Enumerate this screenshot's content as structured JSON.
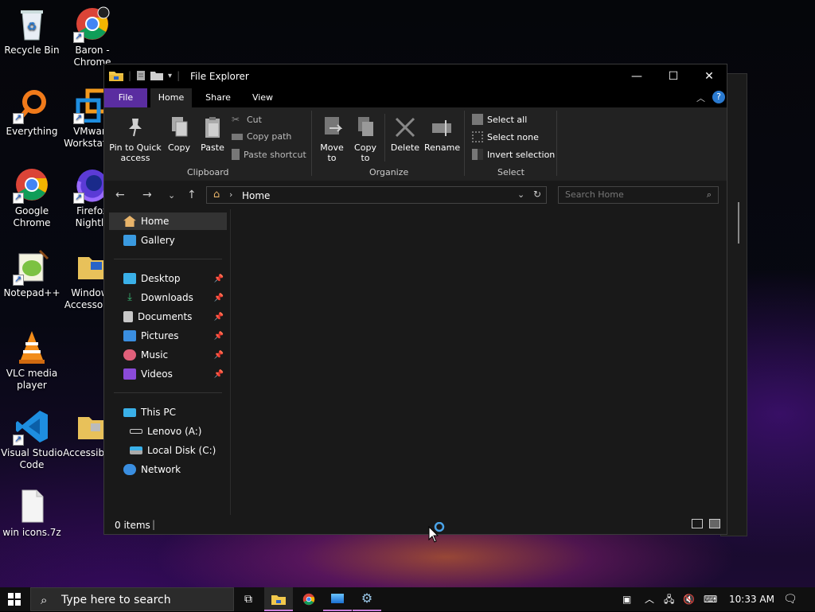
{
  "desktop": {
    "icons": [
      {
        "label": "Recycle Bin"
      },
      {
        "label": "Baron - Chrome"
      },
      {
        "label": "Everything"
      },
      {
        "label": "VMware Workstation"
      },
      {
        "label": "Google Chrome"
      },
      {
        "label": "Firefox Nightly"
      },
      {
        "label": "Notepad++"
      },
      {
        "label": "Windows Accessories"
      },
      {
        "label": "VLC media player"
      },
      {
        "label": "Visual Studio Code"
      },
      {
        "label": "Accessibility"
      },
      {
        "label": "win icons.7z"
      }
    ]
  },
  "window": {
    "title": "File Explorer",
    "controls": {
      "minimize": "—",
      "maximize": "☐",
      "close": "✕"
    },
    "tabs": {
      "file": "File",
      "home": "Home",
      "share": "Share",
      "view": "View"
    },
    "ribbon": {
      "clipboard": {
        "pin": "Pin to Quick access",
        "copy": "Copy",
        "paste": "Paste",
        "cut": "Cut",
        "copy_path": "Copy path",
        "paste_shortcut": "Paste shortcut",
        "group": "Clipboard"
      },
      "organize": {
        "move_to": "Move to",
        "copy_to": "Copy to",
        "delete": "Delete",
        "rename": "Rename",
        "group": "Organize"
      },
      "select": {
        "select_all": "Select all",
        "select_none": "Select none",
        "invert": "Invert selection",
        "group": "Select"
      }
    },
    "address": {
      "path": "Home",
      "search_placeholder": "Search Home"
    },
    "nav": {
      "home": "Home",
      "gallery": "Gallery",
      "desktop": "Desktop",
      "downloads": "Downloads",
      "documents": "Documents",
      "pictures": "Pictures",
      "music": "Music",
      "videos": "Videos",
      "this_pc": "This PC",
      "lenovo": "Lenovo (A:)",
      "local_disk": "Local Disk (C:)",
      "network": "Network"
    },
    "status": {
      "items": "0 items"
    }
  },
  "taskbar": {
    "search_placeholder": "Type here to search",
    "time": "10:33 AM"
  },
  "colors": {
    "accent": "#5a2da0",
    "window_bg": "#191919",
    "ribbon_bg": "#222222"
  }
}
